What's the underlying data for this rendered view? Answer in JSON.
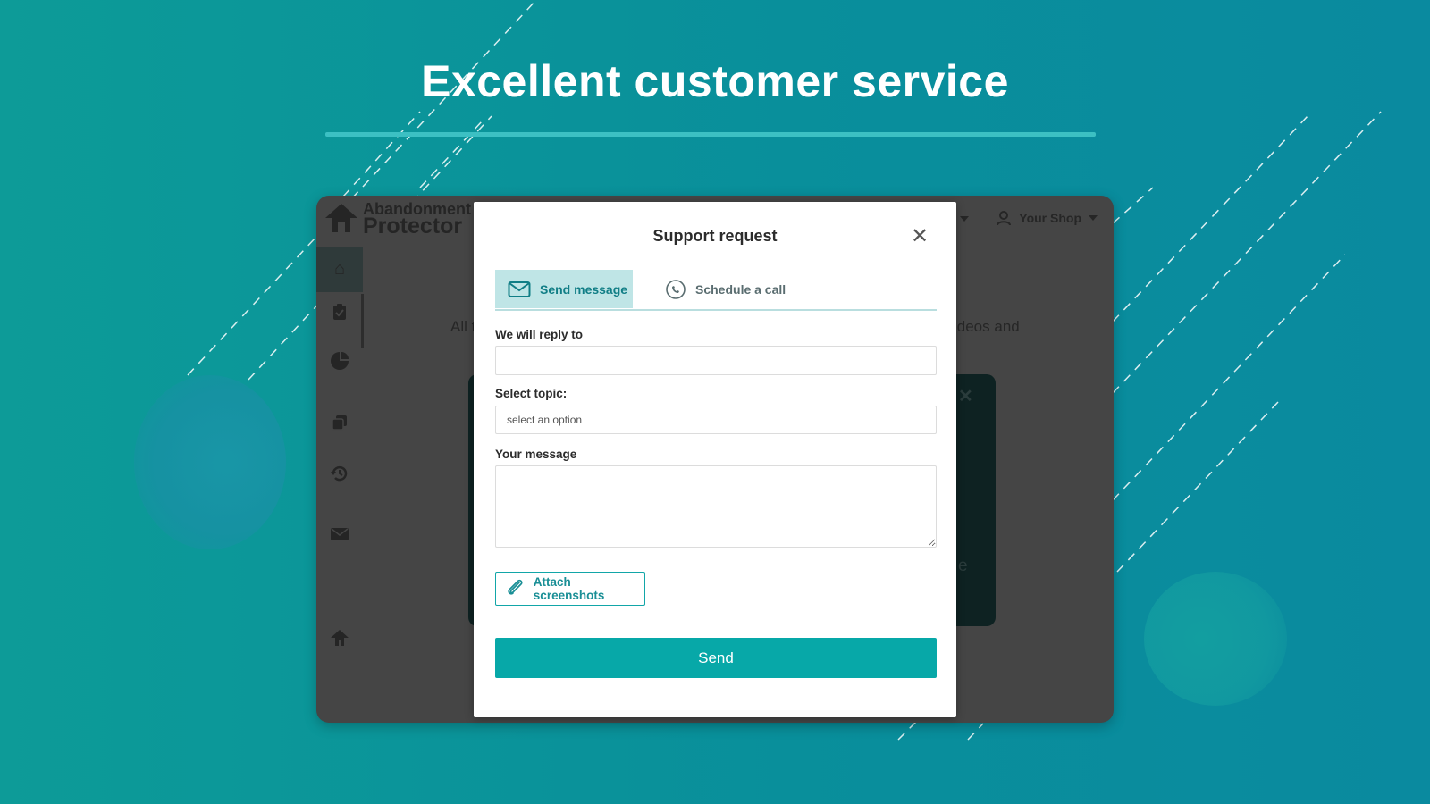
{
  "headline": "Excellent customer service",
  "app": {
    "logo_line1": "Abandonment",
    "logo_line2": "Protector",
    "shop_label": "Your Shop",
    "bg_text_left": "All t",
    "bg_text_right": "ideos and",
    "bg_card_text": "e"
  },
  "modal": {
    "title": "Support request",
    "tabs": [
      {
        "label": "Send message",
        "icon": "envelope-icon",
        "active": true
      },
      {
        "label": "Schedule a call",
        "icon": "phone-icon",
        "active": false
      }
    ],
    "reply_label": "We will reply to",
    "reply_value": "",
    "topic_label": "Select topic:",
    "topic_placeholder": "select an option",
    "message_label": "Your message",
    "message_value": "",
    "attach_label": "Attach screenshots",
    "send_label": "Send"
  },
  "colors": {
    "accent": "#07a8a8",
    "tab_active_bg": "#bfe5e6",
    "background": "#0d9b98"
  }
}
